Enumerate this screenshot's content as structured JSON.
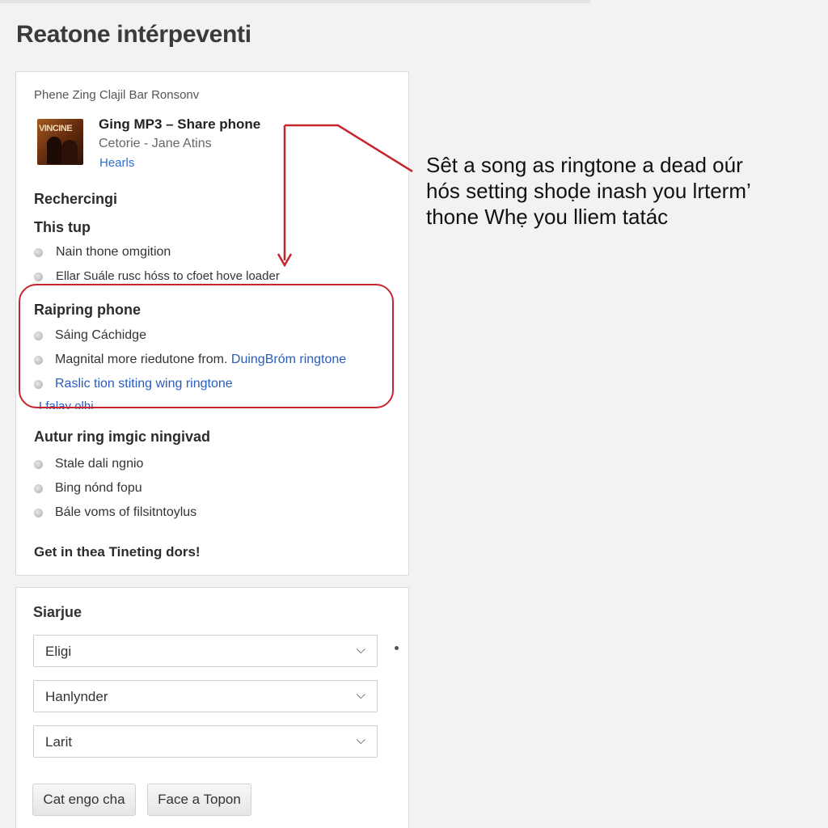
{
  "page_title": "Reatone intérpeventi",
  "breadcrumb": "Phene Zing Clajil Bar Ronsonv",
  "song": {
    "album_art_text": "VINCINE",
    "title": "Ging MP3 – Share phone",
    "artist": "Cetorie - Jane Atins",
    "link": "Hearls"
  },
  "sections": {
    "s1_heading": "Rechercingi",
    "s2_heading": "This tup",
    "s2_items": [
      "Nain thone omgition",
      "Ellar Suále rusc hóss to cfoet hove loader"
    ],
    "s3_heading": "Raipring phone",
    "s3_item1": "Sáing Cáchidge",
    "s3_item2_text": "Magnital more riedutone from.",
    "s3_item2_link": "DuingBróm ringtone",
    "s3_item3_link": "Raslic tion stiting wing ringtone",
    "s3_cut_text": "Lfalay olhi",
    "s4_heading": "Autur ring imgic ningivad",
    "s4_items": [
      "Stale dali ngnio",
      "Bing nónd fopu",
      "Bále voms of filsitntoylus"
    ],
    "footer": "Get in thea Tineting dors!"
  },
  "form": {
    "label": "Siarjue",
    "selects": [
      "Eligi",
      "Hanlynder",
      "Larit"
    ],
    "buttons": [
      "Cat engo cha",
      "Face a Topon"
    ]
  },
  "callout": {
    "lines": [
      "Sêt a song as ringtone a dead oúr",
      "hós setting shoḍe inash you lrterm’",
      "thone Whẹ you lliem tatác"
    ]
  },
  "colors": {
    "annotation_red": "#c6252e",
    "link_blue": "#2a5bbf"
  }
}
